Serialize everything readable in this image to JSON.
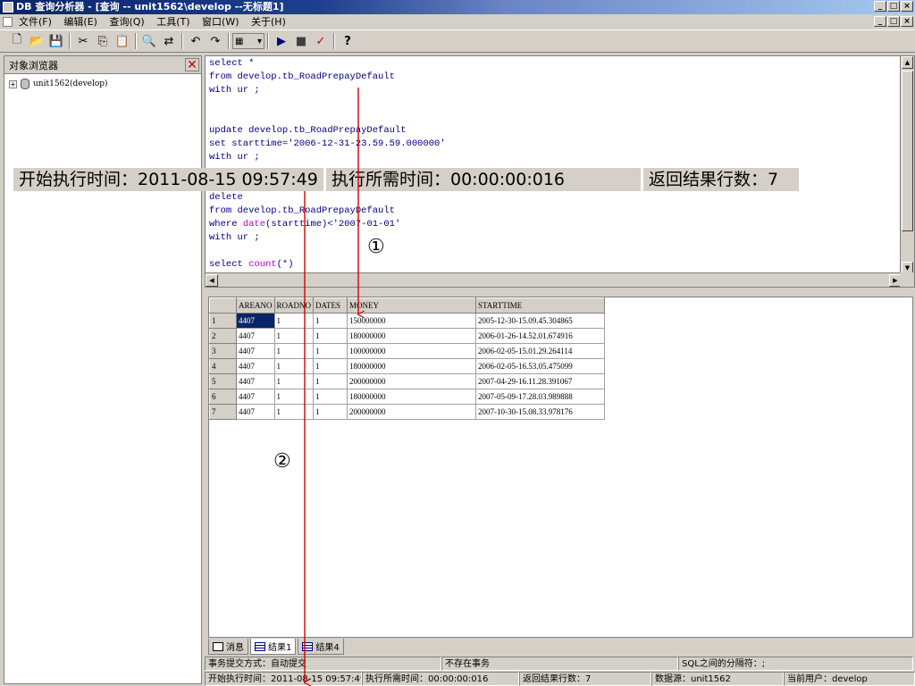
{
  "window": {
    "title": "DB 查询分析器 - [查询 -- unit1562\\develop --无标题1]",
    "min_label": "_",
    "max_label": "□",
    "close_label": "×"
  },
  "menu": [
    "文件(F)",
    "编辑(E)",
    "查询(Q)",
    "工具(T)",
    "窗口(W)",
    "关于(H)"
  ],
  "toolbar": {
    "icons": [
      "new-file-icon",
      "open-folder-icon",
      "save-icon",
      "cut-icon",
      "copy-icon",
      "paste-icon",
      "find-icon",
      "replace-icon",
      "undo-icon",
      "redo-icon",
      "grid-mode-icon",
      "execute-icon",
      "stop-icon",
      "parse-icon",
      "help-icon"
    ],
    "glyphs": {
      "new": "🗋",
      "open": "📂",
      "save": "💾",
      "cut": "✂",
      "copy": "⎘",
      "paste": "📋",
      "find": "🔍",
      "replace": "⇄",
      "undo": "↶",
      "redo": "↷",
      "grid": "▦",
      "execute": "▶",
      "stop": "■",
      "parse": "✓",
      "help": "?"
    }
  },
  "object_browser": {
    "title": "对象浏览器",
    "close": "✕",
    "tree": [
      {
        "expander": "+",
        "label": "unit1562(develop)"
      }
    ]
  },
  "editor": {
    "lines": [
      "select *",
      "from develop.tb_RoadPrepayDefault",
      "with ur ;",
      "",
      "",
      "update develop.tb_RoadPrepayDefault",
      "set starttime='2006-12-31-23.59.59.000000'",
      "with ur ;",
      "",
      "",
      "delete",
      "from develop.tb_RoadPrepayDefault",
      "where date(starttime)<'2007-01-01'",
      "with ur ;",
      "",
      "select count(*)"
    ],
    "line13_parts": [
      "where ",
      "date",
      "(starttime)<'2007-01-01'"
    ],
    "line16_parts": [
      "select ",
      "count",
      "(*)"
    ]
  },
  "results": {
    "columns": [
      "AREANO",
      "ROADNO",
      "DATES",
      "MONEY",
      "STARTTIME"
    ],
    "rows": [
      [
        "1",
        "4407",
        "1",
        "1",
        "150000000",
        "2005-12-30-15.09.45.304865"
      ],
      [
        "2",
        "4407",
        "1",
        "1",
        "180000000",
        "2006-01-26-14.52.01.674916"
      ],
      [
        "3",
        "4407",
        "1",
        "1",
        "100000000",
        "2006-02-05-15.01.29.264114"
      ],
      [
        "4",
        "4407",
        "1",
        "1",
        "180000000",
        "2006-02-05-16.53.05.475099"
      ],
      [
        "5",
        "4407",
        "1",
        "1",
        "200000000",
        "2007-04-29-16.11.28.391067"
      ],
      [
        "6",
        "4407",
        "1",
        "1",
        "180000000",
        "2007-05-09-17.28.03.989888"
      ],
      [
        "7",
        "4407",
        "1",
        "1",
        "200000000",
        "2007-10-30-15.08.33.978176"
      ]
    ]
  },
  "tabs": [
    {
      "label": "消息",
      "icon": "message-icon"
    },
    {
      "label": "结果1",
      "icon": "grid-icon"
    },
    {
      "label": "结果4",
      "icon": "grid-icon"
    }
  ],
  "status1": {
    "commit_mode": "事务提交方式：自动提交",
    "transaction": "不存在事务",
    "separator": "SQL之间的分隔符：;"
  },
  "status2": {
    "start_time": "开始执行时间：2011-08-15 09:57:49",
    "elapsed": "执行所需时间：00:00:00:016",
    "rows": "返回结果行数：7",
    "datasource": "数据源：unit1562",
    "user": "当前用户：develop"
  },
  "overlay": {
    "start_time": "开始执行时间：2011-08-15 09:57:49",
    "elapsed": "执行所需时间：00:00:00:016",
    "rows": "返回结果行数：7"
  },
  "annotations": {
    "one": "①",
    "two": "②"
  }
}
